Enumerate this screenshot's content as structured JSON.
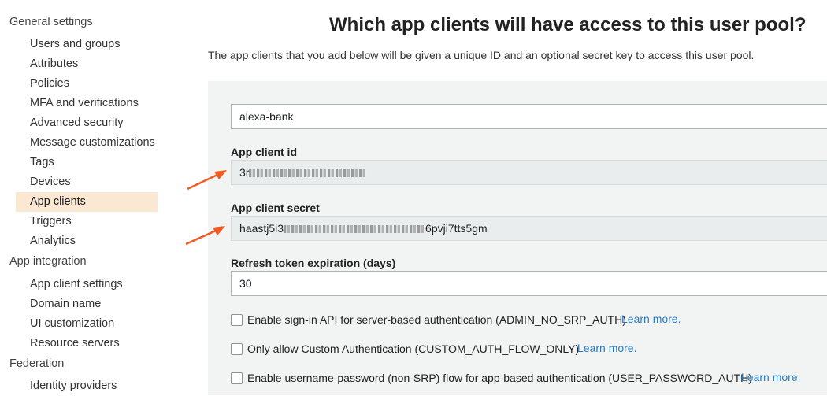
{
  "sidebar": {
    "sections": [
      {
        "title": "General settings",
        "items": [
          "Users and groups",
          "Attributes",
          "Policies",
          "MFA and verifications",
          "Advanced security",
          "Message customizations",
          "Tags",
          "Devices",
          "App clients",
          "Triggers",
          "Analytics"
        ]
      },
      {
        "title": "App integration",
        "items": [
          "App client settings",
          "Domain name",
          "UI customization",
          "Resource servers"
        ]
      },
      {
        "title": "Federation",
        "items": [
          "Identity providers"
        ]
      }
    ],
    "active_item": "App clients"
  },
  "main": {
    "title": "Which app clients will have access to this user pool?",
    "description": "The app clients that you add below will be given a unique ID and an optional secret key to access this user pool.",
    "client_name_value": "alexa-bank",
    "client_id_label": "App client id",
    "client_id_visible": "3r",
    "client_secret_label": "App client secret",
    "client_secret_prefix": "haastj5i3",
    "client_secret_suffix": "6pvji7tts5gm",
    "refresh_label": "Refresh token expiration (days)",
    "refresh_value": "30",
    "options": [
      {
        "label": "Enable sign-in API for server-based authentication (ADMIN_NO_SRP_AUTH)",
        "checked": false,
        "link": "Learn more."
      },
      {
        "label": "Only allow Custom Authentication (CUSTOM_AUTH_FLOW_ONLY)",
        "checked": false,
        "link": "Learn more."
      },
      {
        "label": "Enable username-password (non-SRP) flow for app-based authentication (USER_PASSWORD_AUTH)",
        "checked": false,
        "link": "Learn more."
      }
    ]
  },
  "colors": {
    "active_bg": "#fbe8d2",
    "link": "#2a7bbf",
    "arrow": "#f15a22"
  }
}
